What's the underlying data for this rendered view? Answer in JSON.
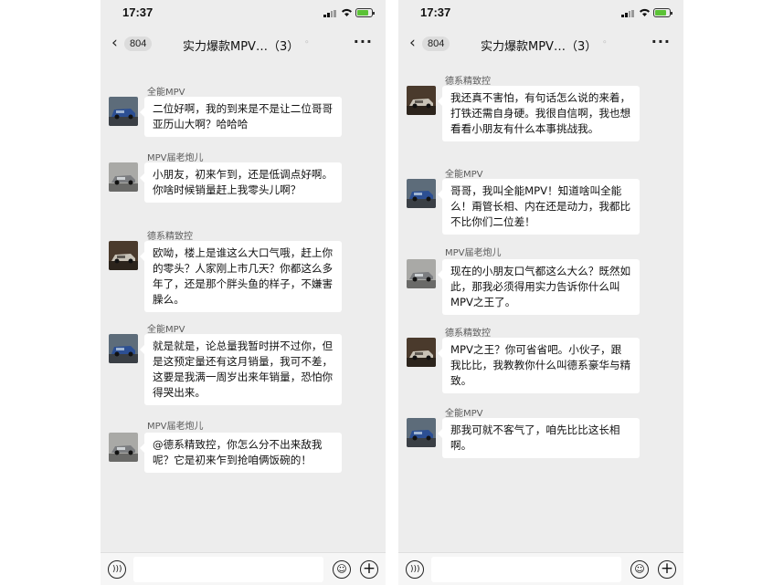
{
  "status": {
    "time": "17:37"
  },
  "nav": {
    "back_count": "804",
    "title": "实力爆款MPV…（3）"
  },
  "left": {
    "messages": [
      {
        "sender": "全能MPV",
        "car": "blue",
        "text": "二位好啊，我的到来是不是让二位哥哥亚历山大啊？哈哈哈"
      },
      {
        "sender": "MPV届老炮儿",
        "car": "gray",
        "text": "小朋友，初来乍到，还是低调点好啊。你啥时候销量赶上我零头儿啊？"
      },
      {
        "sender": "德系精致控",
        "car": "silver",
        "text": "欧呦，楼上是谁这么大口气哦，赶上你的零头？人家刚上市几天？你都这么多年了，还是那个胖头鱼的样子，不嫌害臊么。"
      },
      {
        "sender": "全能MPV",
        "car": "blue",
        "text": "就是就是，论总量我暂时拼不过你，但是这预定量还有这月销量，我可不差，这要是我满一周岁出来年销量，恐怕你得哭出来。"
      },
      {
        "sender": "MPV届老炮儿",
        "car": "gray",
        "text": "@德系精致控，你怎么分不出来敌我呢？它是初来乍到抢咱俩饭碗的！"
      }
    ]
  },
  "right": {
    "messages": [
      {
        "sender": "德系精致控",
        "car": "silver",
        "text": "我还真不害怕，有句话怎么说的来着，打铁还需自身硬。我很自信啊，我也想看看小朋友有什么本事挑战我。"
      },
      {
        "sender": "全能MPV",
        "car": "blue",
        "text": "哥哥，我叫全能MPV！知道啥叫全能么！甭管长相、内在还是动力，我都比不比你们二位差！"
      },
      {
        "sender": "MPV届老炮儿",
        "car": "gray",
        "text": "现在的小朋友口气都这么大么？既然如此，那我必须得用实力告诉你什么叫MPV之王了。"
      },
      {
        "sender": "德系精致控",
        "car": "silver",
        "text": "MPV之王？你可省省吧。小伙子，跟我比比，我教教你什么叫德系豪华与精致。"
      },
      {
        "sender": "全能MPV",
        "car": "blue",
        "text": "那我可就不客气了，咱先比比这长相啊。"
      }
    ]
  },
  "colors": {
    "chat_bg": "#ededed",
    "bubble": "#ffffff",
    "battery": "#5bc236"
  },
  "icons": [
    "back-chevron-icon",
    "mute-icon",
    "more-icon",
    "voice-icon",
    "emoji-icon",
    "plus-icon"
  ]
}
